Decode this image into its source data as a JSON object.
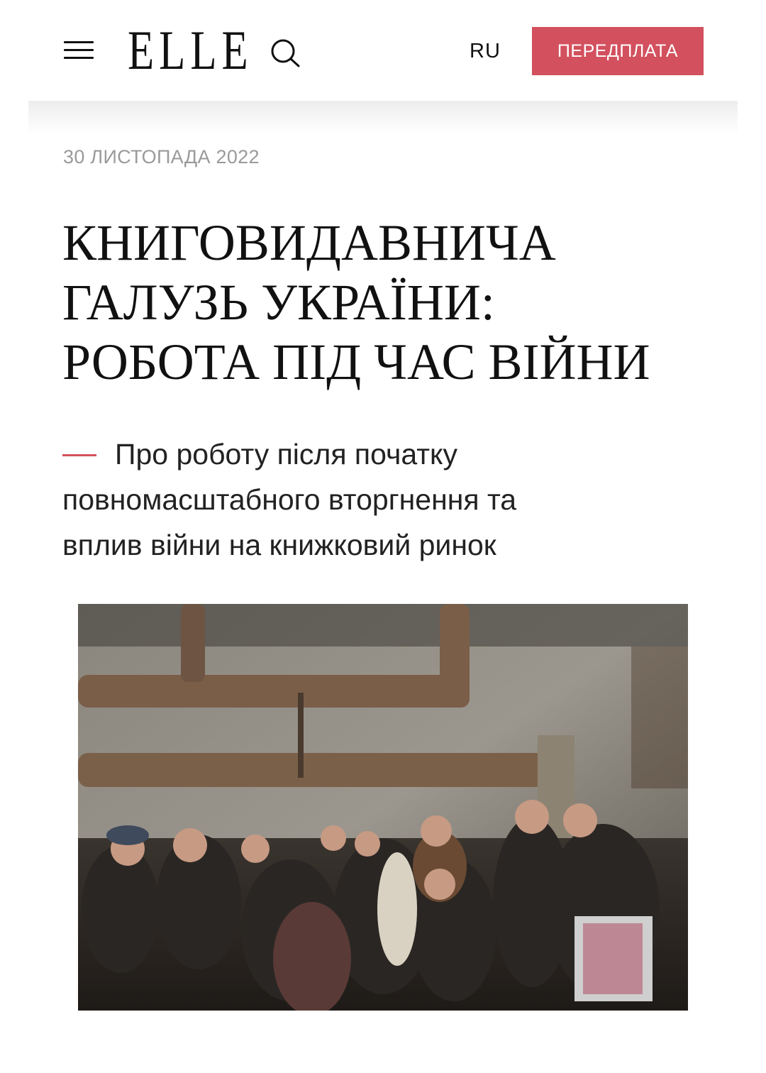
{
  "header": {
    "logo_text": "ELLE",
    "language": "RU",
    "subscribe_label": "ПЕРЕДПЛАТА",
    "accent_color": "#d3505e",
    "icons": [
      "menu-icon",
      "search-icon"
    ]
  },
  "article": {
    "date": "30 ЛИСТОПАДА 2022",
    "title_lines": [
      "КНИГОВИДАВНИЧА",
      "ГАЛУЗЬ УКРАЇНИ:",
      "РОБОТА ПІД ЧАС ВІЙНИ"
    ],
    "lead": "Про роботу після початку повномасштабного вторгнення та вплив війни на книжковий ринок",
    "lead_lines": [
      "Про роботу після початку",
      "повномасштабного вторгнення та",
      "вплив війни на книжковий ринок"
    ]
  }
}
